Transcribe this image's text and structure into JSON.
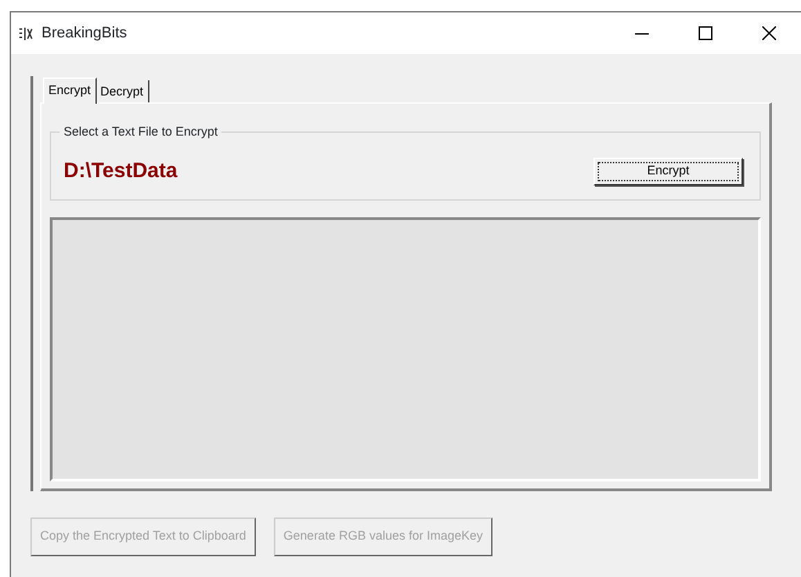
{
  "window": {
    "title": "BreakingBits"
  },
  "tabs": [
    {
      "label": "Encrypt",
      "selected": true
    },
    {
      "label": "Decrypt",
      "selected": false
    }
  ],
  "file_group": {
    "legend": "Select a Text File to Encrypt",
    "path": "D:\\TestData",
    "button": "Encrypt"
  },
  "buttons": [
    {
      "label": "Copy the Encrypted Text to Clipboard",
      "disabled": true
    },
    {
      "label": "Generate RGB values for ImageKey",
      "disabled": true
    }
  ]
}
